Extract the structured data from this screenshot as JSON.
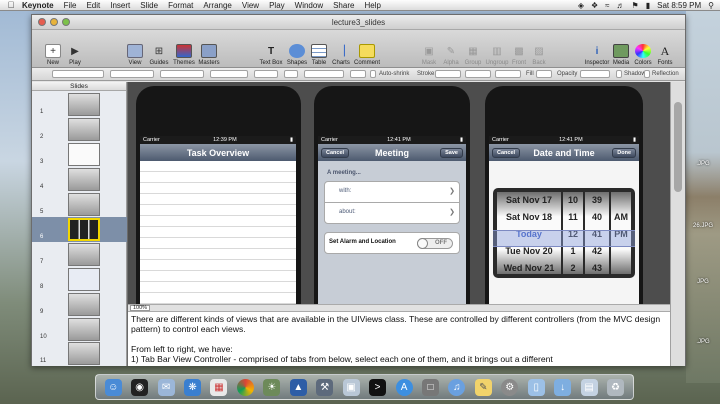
{
  "menubar": {
    "app": "Keynote",
    "items": [
      "File",
      "Edit",
      "Insert",
      "Slide",
      "Format",
      "Arrange",
      "View",
      "Play",
      "Window",
      "Share",
      "Help"
    ],
    "clock": "Sat 8:59 PM"
  },
  "window": {
    "title": "lecture3_slides",
    "toolbar": {
      "new": "New",
      "play": "Play",
      "view": "View",
      "guides": "Guides",
      "themes": "Themes",
      "masters": "Masters",
      "textbox": "Text Box",
      "shapes": "Shapes",
      "table": "Table",
      "charts": "Charts",
      "comment": "Comment",
      "mask": "Mask",
      "alpha": "Alpha",
      "group": "Group",
      "ungroup": "Ungroup",
      "front": "Front",
      "back": "Back",
      "inspector": "Inspector",
      "media": "Media",
      "colors": "Colors",
      "fonts": "Fonts"
    },
    "formatbar": {
      "autoshrink": "Auto-shrink",
      "stroke": "Stroke:",
      "fill": "Fill",
      "opacity": "Opacity",
      "shadow": "Shadow",
      "reflection": "Reflection"
    }
  },
  "slides_panel": {
    "header": "Slides",
    "items": [
      {
        "num": "1"
      },
      {
        "num": "2"
      },
      {
        "num": "3"
      },
      {
        "num": "4"
      },
      {
        "num": "5"
      },
      {
        "num": "6"
      },
      {
        "num": "7"
      },
      {
        "num": "8"
      },
      {
        "num": "9"
      },
      {
        "num": "10"
      },
      {
        "num": "11"
      }
    ],
    "selected": "6"
  },
  "canvas": {
    "phones": [
      {
        "carrier": "Carrier",
        "time": "12:39 PM",
        "nav_title": "Task Overview"
      },
      {
        "carrier": "Carrier",
        "time": "12:41 PM",
        "nav_title": "Meeting",
        "cancel": "Cancel",
        "save": "Save",
        "group_title": "A meeting...",
        "with_label": "with:",
        "about_label": "about:",
        "alarm_label": "Set Alarm and Location",
        "toggle": "OFF"
      },
      {
        "carrier": "Carrier",
        "time": "12:41 PM",
        "nav_title": "Date and Time",
        "cancel": "Cancel",
        "done": "Done",
        "dates": [
          "Sat Nov 17",
          "Sat Nov 18",
          "Today",
          "Tue Nov 20",
          "Wed Nov 21"
        ],
        "hours": [
          "10",
          "11",
          "12",
          "1",
          "2"
        ],
        "minutes": [
          "39",
          "40",
          "41",
          "42",
          "43"
        ],
        "ampm": [
          "AM",
          "PM"
        ]
      }
    ]
  },
  "zoom": "100%",
  "notes": {
    "para1": "There are different kinds of views that are available in the UIViews class. These are controlled by different controllers (from the MVC design pattern) to control each views.",
    "para2": "From left to right, we have:",
    "para3": "1) Tab Bar View Controller - comprised of tabs from below, select each one of them, and it brings out a different"
  },
  "desktop_files": [
    ".JPG",
    "26.JPG",
    "JPG",
    ".JPG"
  ],
  "dock_icons": [
    "finder-icon",
    "dashboard-icon",
    "mail-icon",
    "safari-icon",
    "calendar-icon",
    "chrome-icon",
    "photo-icon",
    "keynote-icon",
    "xcode-icon",
    "preview-icon",
    "terminal-icon",
    "appstore-icon",
    "vmware-icon",
    "itunes-icon",
    "notes-icon",
    "settings-icon",
    "folder-icon",
    "downloads-icon",
    "documents-icon",
    "trash-icon"
  ]
}
